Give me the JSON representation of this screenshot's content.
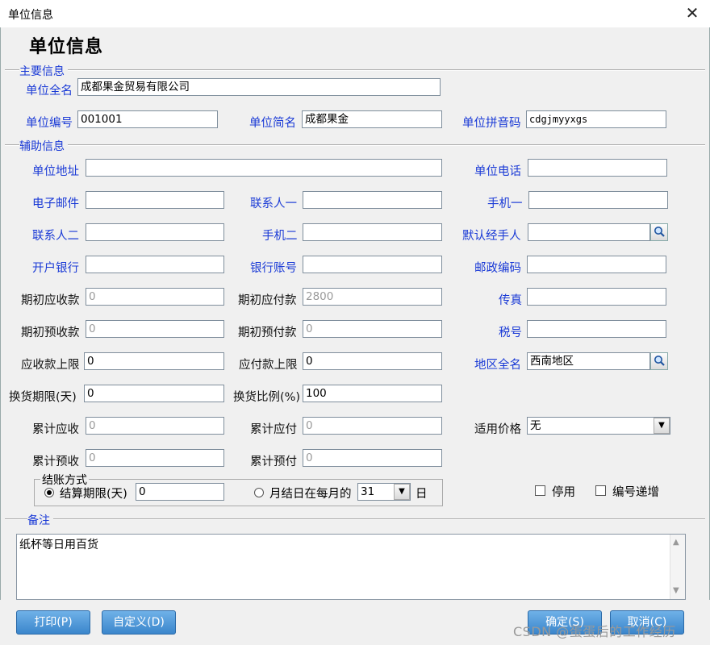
{
  "window": {
    "title": "单位信息",
    "close_glyph": "✕"
  },
  "heading": "单位信息",
  "sections": {
    "main": "主要信息",
    "aux": "辅助信息",
    "settle": "结账方式",
    "remark": "备注"
  },
  "main": {
    "fullname_label": "单位全名",
    "fullname_value": "成都果金贸易有限公司",
    "code_label": "单位编号",
    "code_value": "001001",
    "short_label": "单位简名",
    "short_value": "成都果金",
    "pinyin_label": "单位拼音码",
    "pinyin_value": "cdgjmyyxgs"
  },
  "aux": {
    "address_label": "单位地址",
    "address_value": "",
    "phone_label": "单位电话",
    "phone_value": "",
    "email_label": "电子邮件",
    "email_value": "",
    "contact1_label": "联系人一",
    "contact1_value": "",
    "mobile1_label": "手机一",
    "mobile1_value": "",
    "contact2_label": "联系人二",
    "contact2_value": "",
    "mobile2_label": "手机二",
    "mobile2_value": "",
    "handler_label": "默认经手人",
    "handler_value": "",
    "bank_label": "开户银行",
    "bank_value": "",
    "account_label": "银行账号",
    "account_value": "",
    "zip_label": "邮政编码",
    "zip_value": "",
    "init_recv_label": "期初应收款",
    "init_recv_value": "0",
    "init_pay_label": "期初应付款",
    "init_pay_value": "2800",
    "fax_label": "传真",
    "fax_value": "",
    "init_prerecv_label": "期初预收款",
    "init_prerecv_value": "0",
    "init_prepay_label": "期初预付款",
    "init_prepay_value": "0",
    "tax_label": "税号",
    "tax_value": "",
    "recv_limit_label": "应收款上限",
    "recv_limit_value": "0",
    "pay_limit_label": "应付款上限",
    "pay_limit_value": "0",
    "region_label": "地区全名",
    "region_value": "西南地区",
    "exchange_days_label": "换货期限(天)",
    "exchange_days_value": "0",
    "exchange_ratio_label": "换货比例(%)",
    "exchange_ratio_value": "100",
    "total_recv_label": "累计应收",
    "total_recv_value": "0",
    "total_pay_label": "累计应付",
    "total_pay_value": "0",
    "price_label": "适用价格",
    "price_value": "无",
    "total_prerecv_label": "累计预收",
    "total_prerecv_value": "0",
    "total_prepay_label": "累计预付",
    "total_prepay_value": "0"
  },
  "settle": {
    "opt1_label": "结算期限(天)",
    "opt1_value": "0",
    "opt2_label": "月结日在每月的",
    "opt2_value": "31",
    "opt2_suffix": "日",
    "disabled_label": "停用",
    "autoinc_label": "编号递增"
  },
  "remark": {
    "value": "纸杯等日用百货"
  },
  "buttons": {
    "print": "打印(P)",
    "custom": "自定义(D)",
    "ok": "确定(S)",
    "cancel": "取消(C)"
  },
  "watermark": "CSDN @蛋蛋后的工作经历",
  "icons": {
    "lookup": "magnifier-icon",
    "dropdown": "chevron-down-icon",
    "scroll_up": "▲",
    "scroll_down": "▼"
  },
  "colors": {
    "label_blue": "#1a3ad6",
    "button_blue": "#3b86cc",
    "titlebar_accent": "#2a7fc4"
  }
}
